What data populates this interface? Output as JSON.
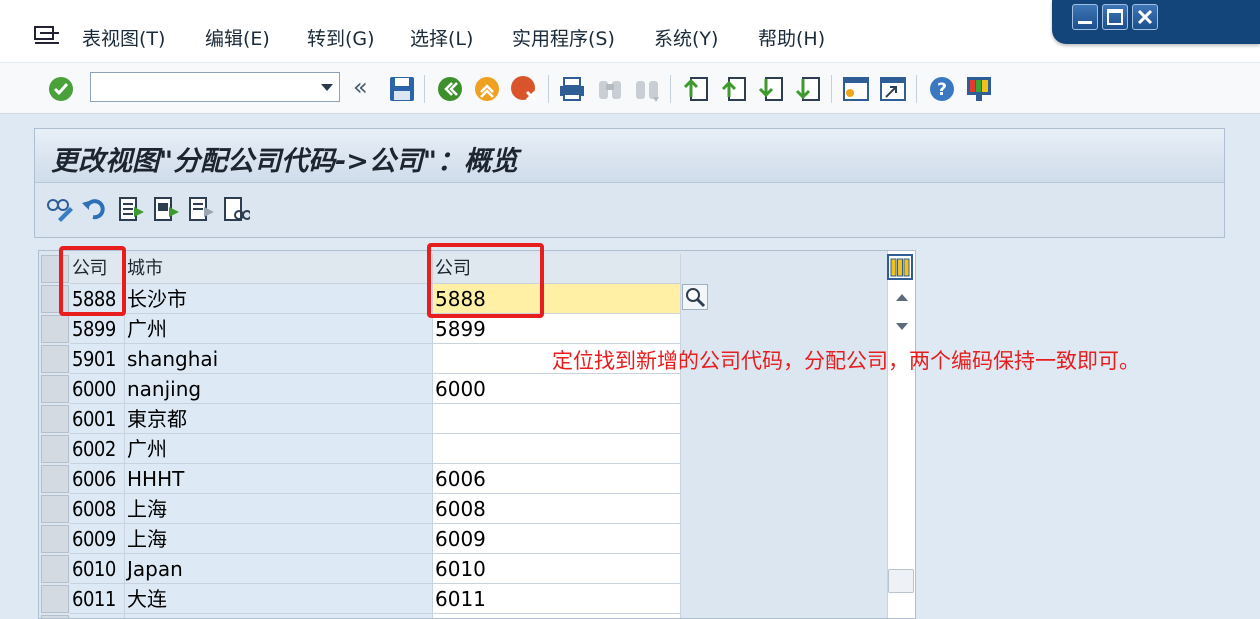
{
  "menu": {
    "items": [
      {
        "label": "表视图(T)"
      },
      {
        "label": "编辑(E)"
      },
      {
        "label": "转到(G)"
      },
      {
        "label": "选择(L)"
      },
      {
        "label": "实用程序(S)"
      },
      {
        "label": "系统(Y)"
      },
      {
        "label": "帮助(H)"
      }
    ]
  },
  "toolbar": {
    "command_value": "",
    "back_label": "«"
  },
  "page": {
    "title": "更改视图\"分配公司代码->公司\"：概览"
  },
  "table": {
    "headers": {
      "code": "公司",
      "city": "城市",
      "company": "公司"
    },
    "rows": [
      {
        "code": "5888",
        "city": "长沙市",
        "company": "5888"
      },
      {
        "code": "5899",
        "city": "广州",
        "company": "5899"
      },
      {
        "code": "5901",
        "city": "shanghai",
        "company": ""
      },
      {
        "code": "6000",
        "city": "nanjing",
        "company": "6000"
      },
      {
        "code": "6001",
        "city": "東京都",
        "company": ""
      },
      {
        "code": "6002",
        "city": "广州",
        "company": ""
      },
      {
        "code": "6006",
        "city": "HHHT",
        "company": "6006"
      },
      {
        "code": "6008",
        "city": "上海",
        "company": "6008"
      },
      {
        "code": "6009",
        "city": "上海",
        "company": "6009"
      },
      {
        "code": "6010",
        "city": "Japan",
        "company": "6010"
      },
      {
        "code": "6011",
        "city": "大连",
        "company": "6011"
      },
      {
        "code": "",
        "city": "",
        "company": ""
      }
    ]
  },
  "annotation": {
    "text": "定位找到新增的公司代码，分配公司，两个编码保持一致即可。"
  },
  "colors": {
    "accent_red": "#e81e1e",
    "focus_yellow": "#fff0a6",
    "window_blue": "#14457a"
  }
}
